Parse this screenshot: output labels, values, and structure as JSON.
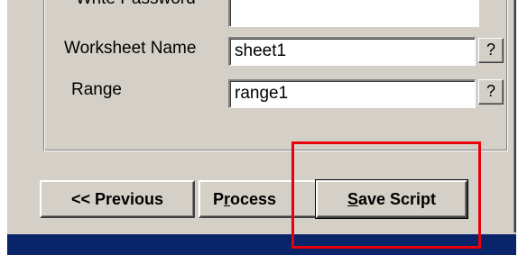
{
  "form": {
    "write_password": {
      "label": "Write Password",
      "value": ""
    },
    "worksheet_name": {
      "label": "Worksheet Name",
      "value": "sheet1",
      "help": "?"
    },
    "range": {
      "label": "Range",
      "value": "range1",
      "help": "?"
    }
  },
  "buttons": {
    "previous": "<< Previous",
    "process": {
      "prefix": "P",
      "accel": "r",
      "suffix": "ocess"
    },
    "save_script": {
      "accel": "S",
      "suffix": "ave Script"
    }
  },
  "colors": {
    "dialog_bg": "#d4d0c8",
    "highlight": "#e8000b",
    "taskbar": "#0a246a"
  }
}
